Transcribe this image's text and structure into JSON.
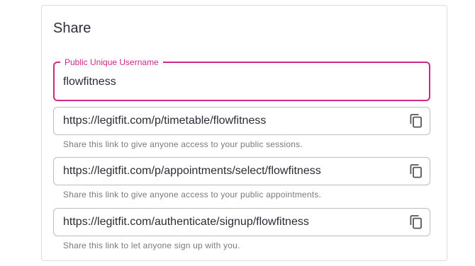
{
  "share": {
    "title": "Share",
    "username_field": {
      "label": "Public Unique Username",
      "value": "flowfitness"
    },
    "links": [
      {
        "url": "https://legitfit.com/p/timetable/flowfitness",
        "helper": "Share this link to give anyone access to your public sessions.",
        "icon": "copy-icon"
      },
      {
        "url": "https://legitfit.com/p/appointments/select/flowfitness",
        "helper": "Share this link to give anyone access to your public appointments.",
        "icon": "copy-icon"
      },
      {
        "url": "https://legitfit.com/authenticate/signup/flowfitness",
        "helper": "Share this link to let anyone sign up with you.",
        "icon": "copy-icon"
      }
    ]
  },
  "colors": {
    "accent": "#cc2a86",
    "border": "#bdbdbd",
    "text": "#2b2b35",
    "helper": "#7a7a7a"
  }
}
